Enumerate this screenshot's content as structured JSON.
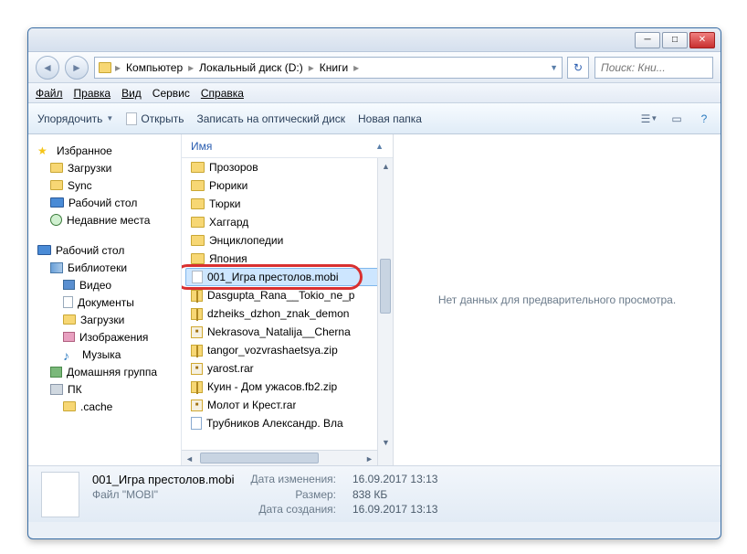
{
  "breadcrumb": {
    "seg0": "Компьютер",
    "seg1": "Локальный диск (D:)",
    "seg2": "Книги"
  },
  "search_placeholder": "Поиск: Кни...",
  "menu": {
    "file": "Файл",
    "edit": "Правка",
    "view": "Вид",
    "tools": "Сервис",
    "help": "Справка"
  },
  "toolbar": {
    "organize": "Упорядочить",
    "open": "Открыть",
    "burn": "Записать на оптический диск",
    "newfolder": "Новая папка"
  },
  "sidebar": {
    "fav": "Избранное",
    "downloads": "Загрузки",
    "sync": "Sync",
    "desktop": "Рабочий стол",
    "recent": "Недавние места",
    "desktop2": "Рабочий стол",
    "libraries": "Библиотеки",
    "video": "Видео",
    "documents": "Документы",
    "downloads2": "Загрузки",
    "pictures": "Изображения",
    "music": "Музыка",
    "homegroup": "Домашняя группа",
    "pc": "ПК",
    "cache": ".cache"
  },
  "column_name": "Имя",
  "files": [
    {
      "name": "Прозоров",
      "type": "folder"
    },
    {
      "name": "Рюрики",
      "type": "folder"
    },
    {
      "name": "Тюрки",
      "type": "folder"
    },
    {
      "name": "Хаггард",
      "type": "folder"
    },
    {
      "name": "Энциклопедии",
      "type": "folder"
    },
    {
      "name": "Япония",
      "type": "folder"
    },
    {
      "name": "001_Игра престолов.mobi",
      "type": "doc",
      "selected": true
    },
    {
      "name": "Dasgupta_Rana__Tokio_ne_p",
      "type": "zip"
    },
    {
      "name": "dzheiks_dzhon_znak_demon",
      "type": "zip"
    },
    {
      "name": "Nekrasova_Natalija__Cherna",
      "type": "rar"
    },
    {
      "name": "tangor_vozvrashaetsya.zip",
      "type": "zip"
    },
    {
      "name": "yarost.rar",
      "type": "rar"
    },
    {
      "name": "Куин - Дом ужасов.fb2.zip",
      "type": "zip"
    },
    {
      "name": "Молот и Крест.rar",
      "type": "rar"
    },
    {
      "name": "Трубников Александр. Вла",
      "type": "web"
    }
  ],
  "preview_text": "Нет данных для предварительного просмотра.",
  "status": {
    "filename": "001_Игра престолов.mobi",
    "filetype": "Файл \"MOBI\"",
    "modified_label": "Дата изменения:",
    "modified_value": "16.09.2017 13:13",
    "size_label": "Размер:",
    "size_value": "838 КБ",
    "created_label": "Дата создания:",
    "created_value": "16.09.2017 13:13"
  }
}
